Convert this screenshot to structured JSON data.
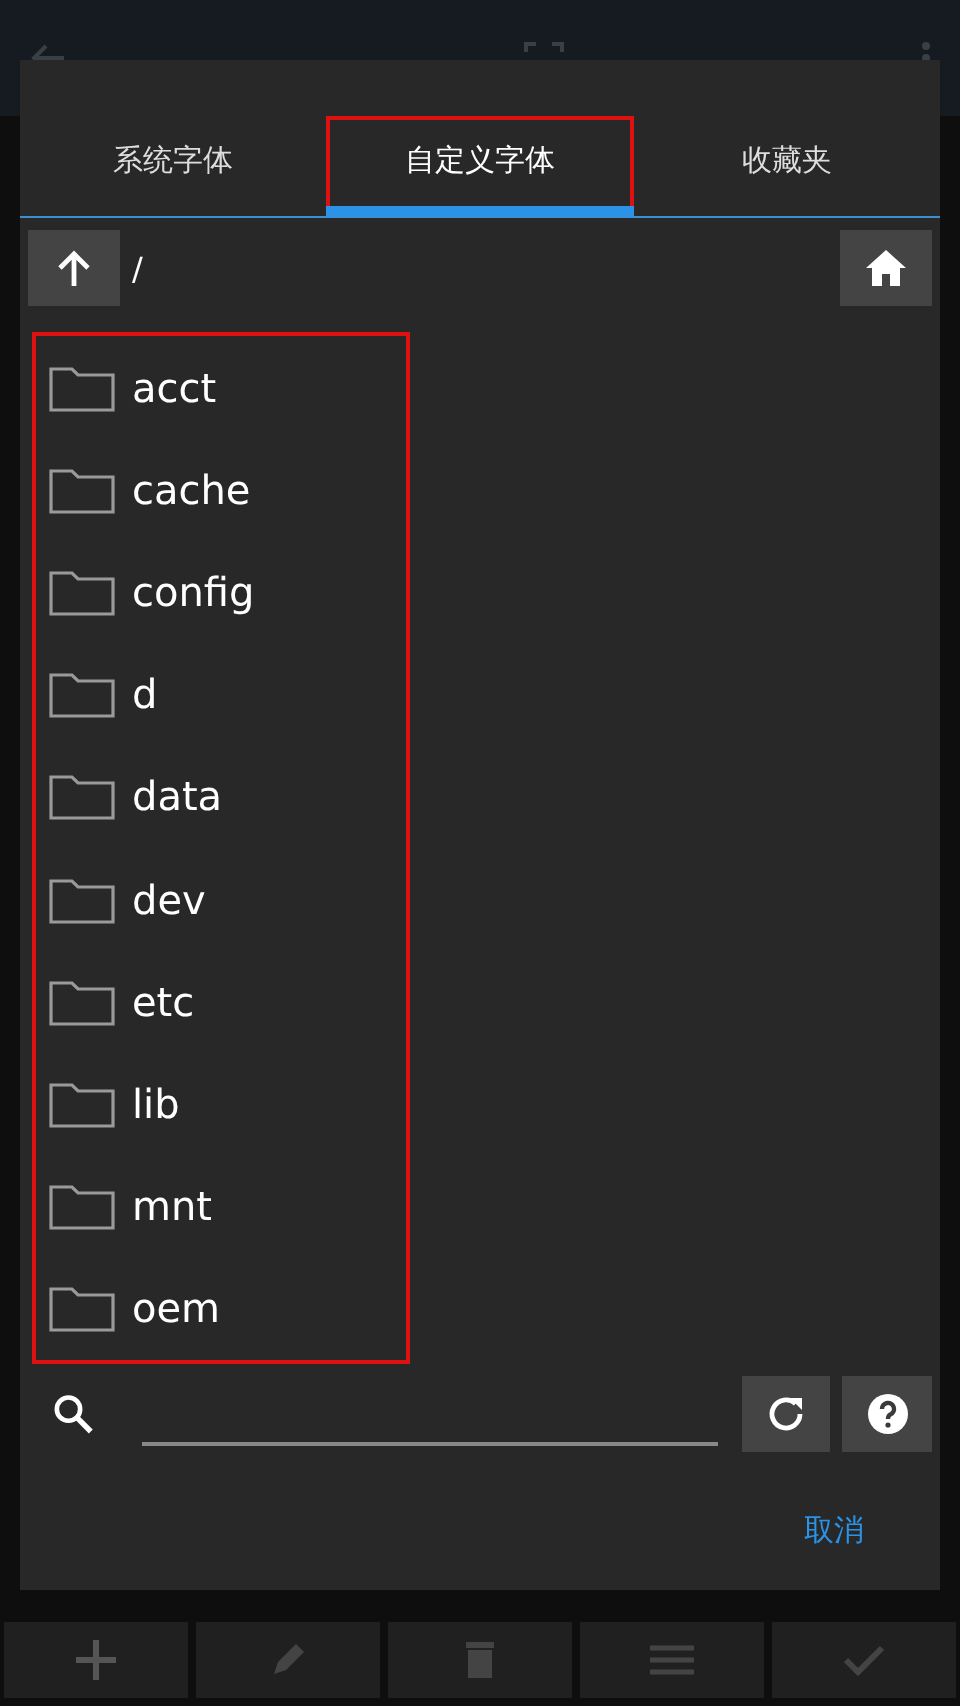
{
  "tabs": [
    {
      "label": "系统字体",
      "selected": false,
      "highlighted": false
    },
    {
      "label": "自定义字体",
      "selected": true,
      "highlighted": true
    },
    {
      "label": "收藏夹",
      "selected": false,
      "highlighted": false
    }
  ],
  "path": "/",
  "file_list": {
    "highlighted": true,
    "folders": [
      {
        "name": "acct"
      },
      {
        "name": "cache"
      },
      {
        "name": "config"
      },
      {
        "name": "d"
      },
      {
        "name": "data"
      },
      {
        "name": "dev"
      },
      {
        "name": "etc"
      },
      {
        "name": "lib"
      },
      {
        "name": "mnt"
      },
      {
        "name": "oem"
      }
    ]
  },
  "cancel_button": "取消"
}
